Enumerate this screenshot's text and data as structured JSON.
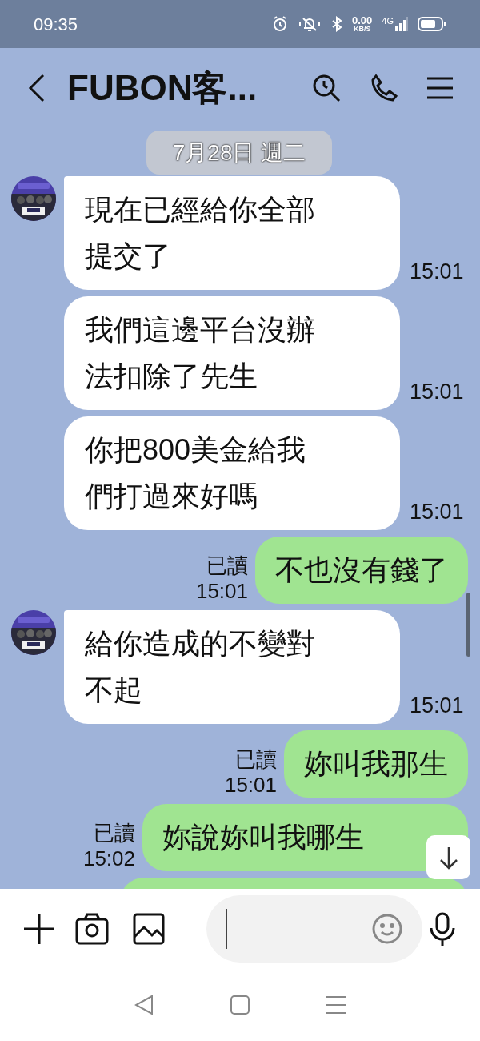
{
  "status_bar": {
    "time": "09:35",
    "speed_value": "0.00",
    "speed_unit": "KB/S",
    "network": "4G"
  },
  "header": {
    "title": "FUBON客..."
  },
  "date_pill": "7月28日 週二",
  "messages": [
    {
      "kind": "incoming",
      "avatar": true,
      "text": "現在已經給你全部提交了",
      "time": "15:01"
    },
    {
      "kind": "incoming",
      "avatar": false,
      "text": "我們這邊平台沒辦法扣除了先生",
      "time": "15:01"
    },
    {
      "kind": "incoming",
      "avatar": false,
      "text": "你把800美金給我們打過來好嗎",
      "time": "15:01"
    },
    {
      "kind": "outgoing",
      "read": "已讀",
      "text": "不也沒有錢了",
      "time": "15:01"
    },
    {
      "kind": "incoming",
      "avatar": true,
      "text": "給你造成的不變對不起",
      "time": "15:01"
    },
    {
      "kind": "outgoing",
      "read": "已讀",
      "text": "妳叫我那生",
      "time": "15:01"
    },
    {
      "kind": "outgoing",
      "read": "已讀",
      "text": "妳說妳叫我哪生",
      "time": "15:02",
      "cut_off": true
    },
    {
      "kind": "outgoing_partial"
    }
  ]
}
